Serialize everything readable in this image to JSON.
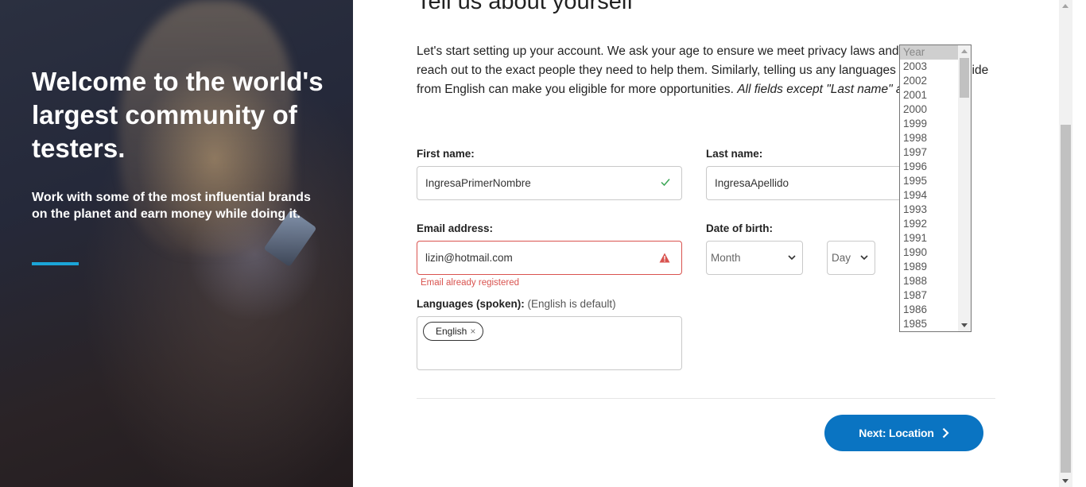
{
  "hero": {
    "title": "Welcome to the world's largest community of testers.",
    "subtitle": "Work with some of the most influential brands on the planet and earn money while doing it.",
    "accent_color": "#1ba5d8"
  },
  "form": {
    "heading": "Tell us about yourself",
    "intro_plain": "Let's start setting up your account. We ask your age to ensure we meet privacy laws and help brands reach out to the exact people they need to help them. Similarly, telling us any languages you speak aside from English can make you eligible for more opportunities. ",
    "intro_italic": "All fields except \"Last name\" are required.",
    "first_name": {
      "label": "First name:",
      "value": "IngresaPrimerNombre",
      "status_icon": "check-icon"
    },
    "last_name": {
      "label": "Last name:",
      "value": "IngresaApellido"
    },
    "email": {
      "label": "Email address:",
      "value": "lizin@hotmail.com",
      "status_icon": "warning-icon",
      "error": "Email already registered"
    },
    "dob": {
      "label": "Date of birth:",
      "month": "Month",
      "day": "Day",
      "year": "Year"
    },
    "languages": {
      "label": "Languages (spoken):",
      "hint": "(English is default)",
      "tags": [
        "English"
      ],
      "remove_symbol": "×"
    },
    "next_button": "Next: Location"
  },
  "year_options": [
    "Year",
    "2003",
    "2002",
    "2001",
    "2000",
    "1999",
    "1998",
    "1997",
    "1996",
    "1995",
    "1994",
    "1993",
    "1992",
    "1991",
    "1990",
    "1989",
    "1988",
    "1987",
    "1986",
    "1985"
  ],
  "colors": {
    "primary_button": "#0a74c2",
    "error": "#d9534f",
    "success": "#3aa655"
  }
}
